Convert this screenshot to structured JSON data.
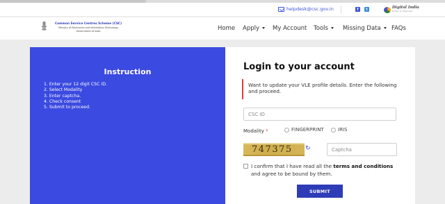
{
  "topbar": {
    "helpdesk_email": "helpdesk@csc.gov.in",
    "social_icons": [
      "facebook-icon",
      "twitter-icon"
    ],
    "digital_india_text": "Digital India",
    "digital_india_sub": "Power To Empower"
  },
  "brand": {
    "line1": "Common Service Centres Scheme (CSC)",
    "line2": "Ministry of Electronics and Information Technology",
    "line3": "Government of India"
  },
  "nav": {
    "items": [
      {
        "label": "Home",
        "dropdown": false
      },
      {
        "label": "Apply",
        "dropdown": true
      },
      {
        "label": "My Account",
        "dropdown": false
      },
      {
        "label": "Tools",
        "dropdown": true
      },
      {
        "label": "Missing Data",
        "dropdown": true
      },
      {
        "label": "FAQs",
        "dropdown": false
      }
    ]
  },
  "instruction": {
    "title": "Instruction",
    "steps": [
      "1. Enter your 12 digit CSC ID.",
      "2. Select Modality",
      "3. Enter captcha.",
      "4. Check consent",
      "5. Submit to proceed."
    ]
  },
  "login": {
    "title": "Login to your account",
    "notice": "Want to update your VLE profile details. Enter the following and proceed.",
    "csc_id_placeholder": "CSC ID",
    "csc_id_value": "",
    "modality_label": "Modality",
    "modality_required_mark": "*",
    "modality_options": [
      "FINGERPRINT",
      "IRIS"
    ],
    "captcha_text": "747375",
    "captcha_placeholder": "Captcha",
    "consent_prefix": "I confirm that I have read all the ",
    "consent_bold": "terms and conditions",
    "consent_suffix": " and agree to be bound by them.",
    "submit_label": "SUBMIT"
  },
  "colors": {
    "accent": "#3b4ae0",
    "button": "#2f3cb8",
    "required": "#e03b3b"
  }
}
